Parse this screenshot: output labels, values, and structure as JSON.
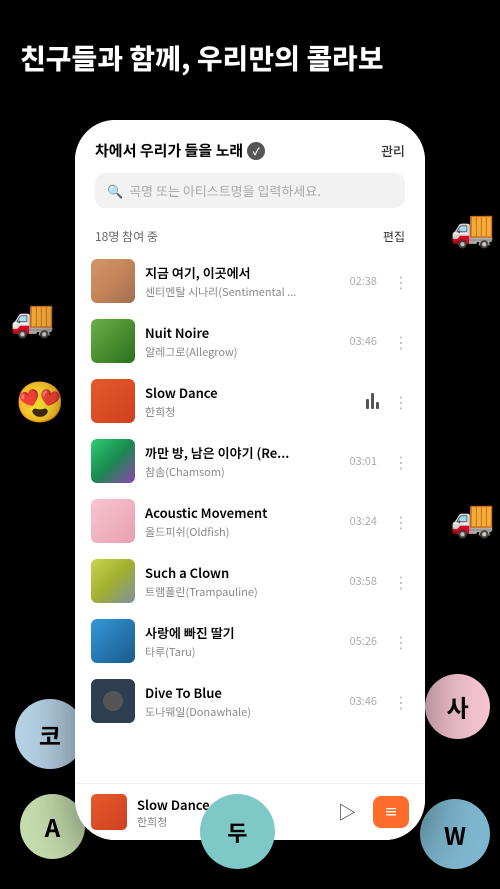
{
  "header": {
    "title_line1": "친구들과 함께, 우리만의 콜라보"
  },
  "floats": {
    "truck_emoji": "🚚",
    "love_emoji": "😍",
    "ko_label": "코",
    "a_label": "A",
    "du_label": "두",
    "sa_label": "사",
    "w_label": "W"
  },
  "phone": {
    "playlist_title": "차에서 우리가 들을 노래",
    "manage_label": "관리",
    "search_placeholder": "곡명 또는 아티스트명을 입력하세요.",
    "participants_text": "18명 참여 중",
    "edit_label": "편집",
    "songs": [
      {
        "title": "지금 여기, 이곳에서",
        "artist": "센티멘탈 시나리(Sentimental ...",
        "duration": "02:38",
        "thumb_class": "thumb-1"
      },
      {
        "title": "Nuit Noire",
        "artist": "알레그로(Allegrow)",
        "duration": "03:46",
        "thumb_class": "thumb-2"
      },
      {
        "title": "Slow Dance",
        "artist": "한희청",
        "duration": "",
        "thumb_class": "thumb-3",
        "playing": true
      },
      {
        "title": "까만 방, 남은 이야기 (Re...",
        "artist": "참솜(Chamsom)",
        "duration": "03:01",
        "thumb_class": "thumb-4"
      },
      {
        "title": "Acoustic Movement",
        "artist": "올드피쉬(Oldfish)",
        "duration": "03:24",
        "thumb_class": "thumb-5"
      },
      {
        "title": "Such a Clown",
        "artist": "트램폴린(Trampauline)",
        "duration": "03:58",
        "thumb_class": "thumb-6"
      },
      {
        "title": "사랑에 빠진 딸기",
        "artist": "타루(Taru)",
        "duration": "05:26",
        "thumb_class": "thumb-7"
      },
      {
        "title": "Dive To Blue",
        "artist": "도나웨일(Donawhale)",
        "duration": "03:46",
        "thumb_class": "thumb-8"
      }
    ],
    "player": {
      "title": "Slow Dance",
      "artist": "한희청",
      "play_icon": "▷",
      "queue_icon": "☰"
    }
  }
}
